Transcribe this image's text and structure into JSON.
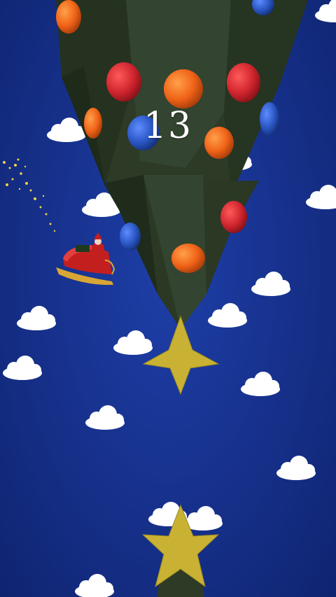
{
  "game": {
    "score": "13",
    "theme": "night sky",
    "colors": {
      "sky": "#1a3798",
      "cloud": "#ffffff",
      "tree": "#2c3a26",
      "tree_dark": "#1f2b1b",
      "star": "#c9b233",
      "ornament_red": "#d1262f",
      "ornament_orange": "#f06318",
      "ornament_blue": "#2a57c4",
      "sleigh": "#c41f1f",
      "sleigh_trim": "#d8a634",
      "sparkle": "#f1d24a"
    },
    "objects": [
      "christmas-tree",
      "tree-top-star",
      "santa-sleigh",
      "clouds",
      "ornaments",
      "sparkle-trail",
      "next-tree-star"
    ]
  }
}
